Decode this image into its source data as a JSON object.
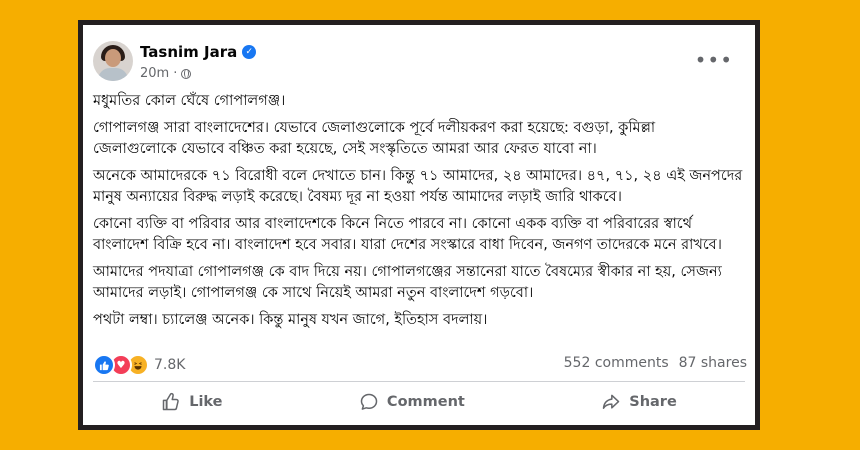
{
  "post": {
    "author": "Tasnim Jara",
    "time": "20m",
    "paragraphs": [
      "মধুমতির কোল ঘেঁষে গোপালগঞ্জ।",
      "গোপালগঞ্জ সারা বাংলাদেশের। যেভাবে জেলাগুলোকে পূর্বে দলীয়করণ করা হয়েছে: বগুড়া, কুমিল্লা জেলাগুলোকে যেভাবে বঞ্চিত করা হয়েছে, সেই সংস্কৃতিতে আমরা আর ফেরত যাবো না।",
      "অনেকে আমাদেরকে ৭১ বিরোধী বলে দেখাতে চান। কিন্তু ৭১ আমাদের, ২৪ আমাদের। ৪৭, ৭১, ২৪ এই জনপদের মানুষ অন্যায়ের বিরুদ্ধ লড়াই করেছে। বৈষম্য দূর না হওয়া পর্যন্ত আমাদের লড়াই জারি থাকবে।",
      "কোনো ব্যক্তি বা পরিবার আর বাংলাদেশকে কিনে নিতে পারবে না। কোনো একক ব্যক্তি বা পরিবারের স্বার্থে বাংলাদেশ বিক্রি হবে না। বাংলাদেশ হবে সবার। যারা দেশের সংস্কারে বাধা দিবেন, জনগণ তাদেরকে মনে রাখবে।",
      "আমাদের পদযাত্রা গোপালগঞ্জ কে বাদ দিয়ে নয়। গোপালগঞ্জের সন্তানেরা যাতে বৈষম্যের স্বীকার না হয়, সেজন্য আমাদের লড়াই। গোপালগঞ্জ কে সাথে নিয়েই আমরা নতুন বাংলাদেশ গড়বো।",
      "পথটা লম্বা। চ্যালেঞ্জ অনেক। কিন্তু মানুষ যখন জাগে, ইতিহাস বদলায়।"
    ],
    "reaction_count": "7.8K",
    "comments": "552 comments",
    "shares": "87 shares"
  },
  "actions": {
    "like": "Like",
    "comment": "Comment",
    "share": "Share"
  },
  "colors": {
    "background": "#f6ae00",
    "like_blue": "#1877f2",
    "love_red": "#f33e58",
    "haha_yellow": "#f7b125",
    "muted_text": "#65676b"
  },
  "icons": [
    "verified-badge-icon",
    "globe-icon",
    "more-options-icon",
    "like-reaction-icon",
    "love-reaction-icon",
    "haha-reaction-icon",
    "thumbs-up-icon",
    "comment-bubble-icon",
    "share-arrow-icon"
  ]
}
